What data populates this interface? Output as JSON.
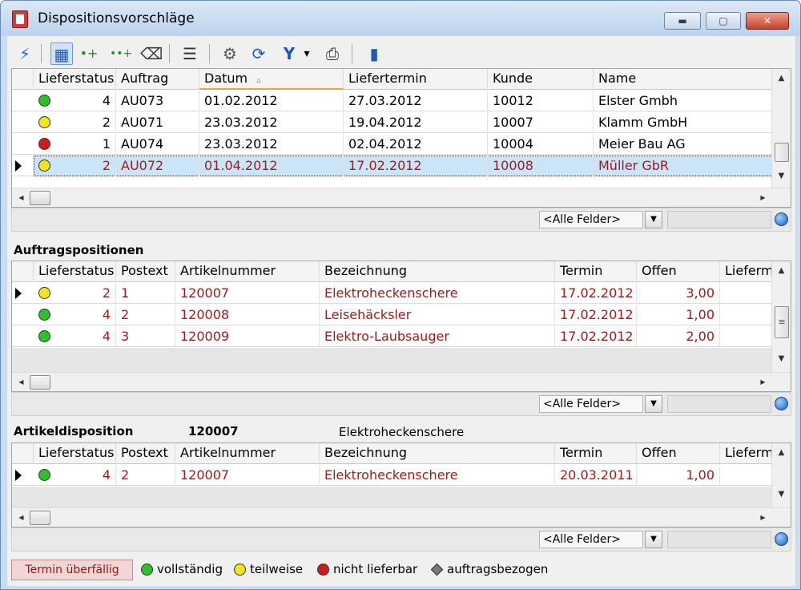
{
  "window": {
    "title": "Dispositionsvorschläge",
    "minimize_glyph": "▬",
    "maximize_glyph": "▢",
    "close_glyph": "✕"
  },
  "colors": {
    "green": "#2fbf2a",
    "yellow": "#f2e51b",
    "red": "#d11a1a",
    "overdue_text": "#9a1b1b"
  },
  "toolbar": {
    "icons": [
      "lightning-icon",
      "table-view-icon",
      "add-node-icon",
      "add-nodes-icon",
      "eraser-icon",
      "list-numbered-icon",
      "properties-icon",
      "refresh-icon",
      "filter-icon",
      "filter-dropdown-icon",
      "print-icon",
      "book-icon"
    ],
    "glyphs": [
      "⚡",
      "▦",
      "•+",
      "••+",
      "⌫",
      "☰",
      "⚙",
      "⟳",
      "Y",
      "▾",
      "⎙",
      "▮"
    ]
  },
  "orders": {
    "columns": [
      "Lieferstatus",
      "Auftrag",
      "Datum",
      "Liefertermin",
      "Kunde",
      "Name"
    ],
    "sort_glyph": "▵",
    "rows": [
      {
        "status": "green",
        "count": "4",
        "auftrag": "AU073",
        "datum": "01.02.2012",
        "liefertermin": "27.03.2012",
        "kunde": "10012",
        "name": "Elster Gmbh"
      },
      {
        "status": "yellow",
        "count": "2",
        "auftrag": "AU071",
        "datum": "23.03.2012",
        "liefertermin": "19.04.2012",
        "kunde": "10007",
        "name": "Klamm GmbH"
      },
      {
        "status": "red",
        "count": "1",
        "auftrag": "AU074",
        "datum": "23.03.2012",
        "liefertermin": "02.04.2012",
        "kunde": "10004",
        "name": "Meier Bau AG"
      },
      {
        "status": "yellow",
        "count": "2",
        "auftrag": "AU072",
        "datum": "01.04.2012",
        "liefertermin": "17.02.2012",
        "kunde": "10008",
        "name": "Müller GbR"
      }
    ],
    "filter_select": "<Alle Felder>"
  },
  "positions": {
    "label": "Auftragspositionen",
    "columns": [
      "Lieferstatus",
      "Postext",
      "Artikelnummer",
      "Bezeichnung",
      "Termin",
      "Offen",
      "Lieferm"
    ],
    "rows": [
      {
        "status": "yellow",
        "count": "2",
        "postext": "1",
        "artikel": "120007",
        "bezeichnung": "Elektroheckenschere",
        "termin": "17.02.2012",
        "offen": "3,00"
      },
      {
        "status": "green",
        "count": "4",
        "postext": "2",
        "artikel": "120008",
        "bezeichnung": "Leisehäcksler",
        "termin": "17.02.2012",
        "offen": "1,00"
      },
      {
        "status": "green",
        "count": "4",
        "postext": "3",
        "artikel": "120009",
        "bezeichnung": "Elektro-Laubsauger",
        "termin": "17.02.2012",
        "offen": "2,00"
      }
    ],
    "filter_select": "<Alle Felder>"
  },
  "disposition": {
    "label": "Artikeldisposition",
    "article_no": "120007",
    "article_name": "Elektroheckenschere",
    "columns": [
      "Lieferstatus",
      "Postext",
      "Artikelnummer",
      "Bezeichnung",
      "Termin",
      "Offen",
      "Lieferm"
    ],
    "rows": [
      {
        "status": "green",
        "count": "4",
        "postext": "2",
        "artikel": "120007",
        "bezeichnung": "Elektroheckenschere",
        "termin": "20.03.2011",
        "offen": "1,00"
      }
    ],
    "filter_select": "<Alle Felder>"
  },
  "legend": {
    "overdue": "Termin überfällig",
    "complete": "vollständig",
    "partial": "teilweise",
    "unavailable": "nicht lieferbar",
    "order_related": "auftragsbezogen"
  },
  "scroll": {
    "up": "▲",
    "down": "▼",
    "left": "◀",
    "right": "▶",
    "grip": "≡"
  }
}
